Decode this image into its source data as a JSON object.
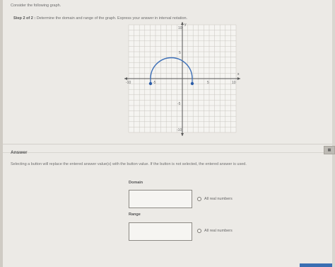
{
  "question": {
    "prompt": "Consider the following graph.",
    "step_label": "Step 2 of 2 :",
    "step_text": "Determine the domain and range of the graph. Express your answer in interval notation."
  },
  "graph": {
    "tick_labels": {
      "x_neg": "-10",
      "x_pos": "10",
      "x_pos_small": "5",
      "x_neg_small": "-5",
      "y_pos": "10",
      "y_pos_small": "5",
      "y_neg_small": "-5",
      "y_neg": "-10"
    },
    "axis_x": "x",
    "axis_y": "y"
  },
  "answer": {
    "title": "Answer",
    "calculator_label": "▦",
    "instructions": "Selecting a button will replace the entered answer value(s) with the button value. If the button is not selected, the entered answer is used.",
    "domain": {
      "label": "Domain",
      "value": "",
      "option": "All real numbers"
    },
    "range": {
      "label": "Range",
      "value": "",
      "option": "All real numbers"
    }
  }
}
